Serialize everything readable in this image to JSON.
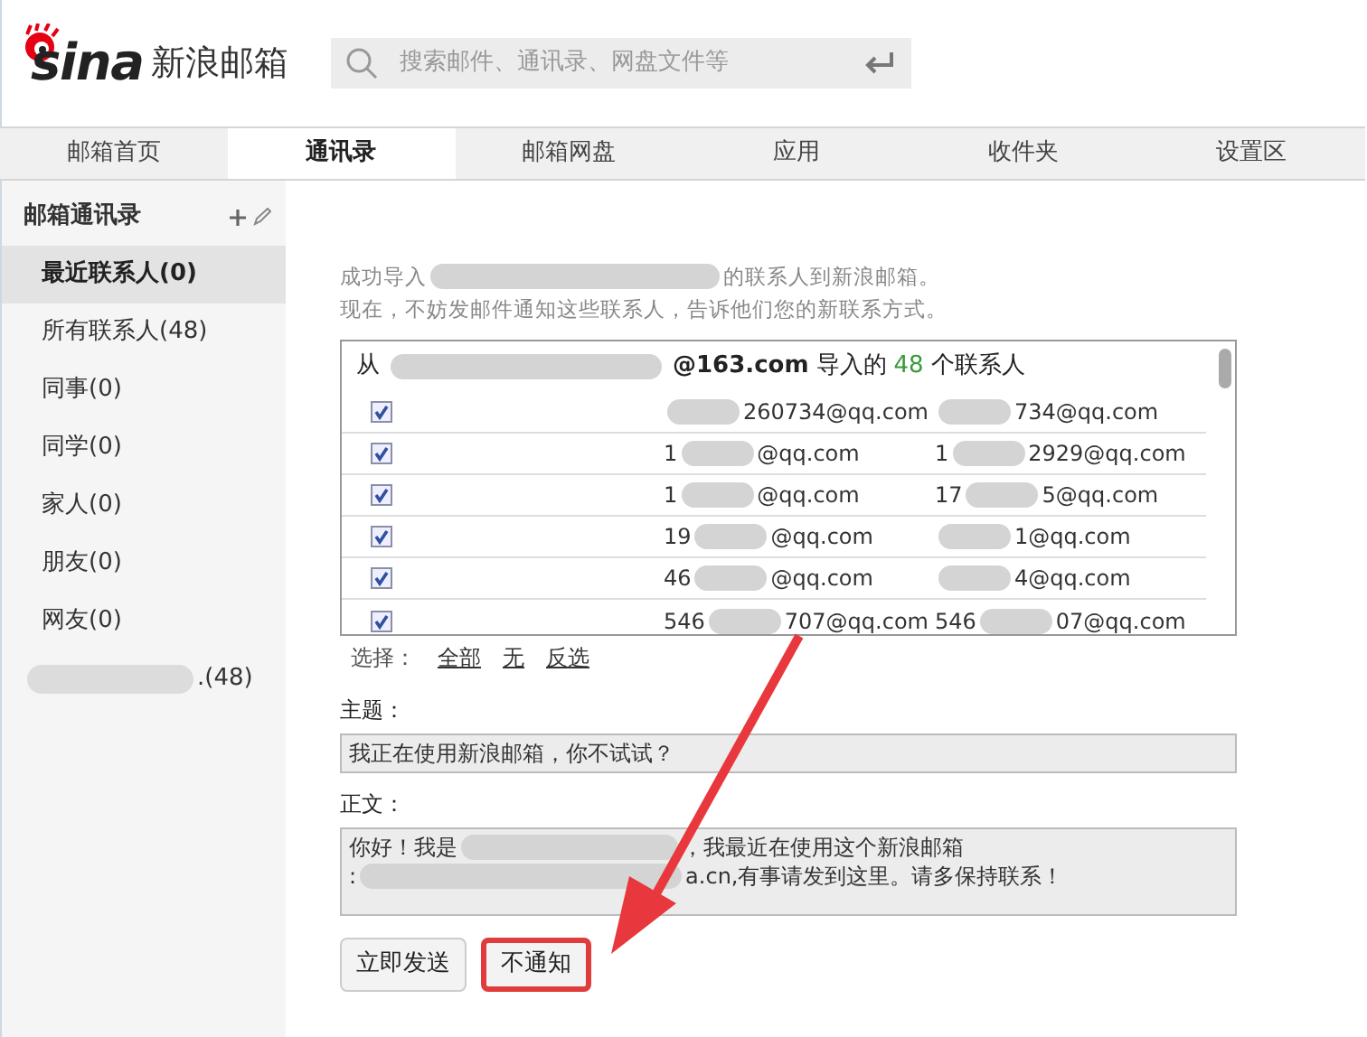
{
  "logo": {
    "brand": "sina",
    "product": "新浪邮箱"
  },
  "search": {
    "placeholder": "搜索邮件、通讯录、网盘文件等"
  },
  "tabs": [
    {
      "label": "邮箱首页",
      "selected": false
    },
    {
      "label": "通讯录",
      "selected": true
    },
    {
      "label": "邮箱网盘",
      "selected": false
    },
    {
      "label": "应用",
      "selected": false
    },
    {
      "label": "收件夹",
      "selected": false
    },
    {
      "label": "设置区",
      "selected": false
    }
  ],
  "sidebar": {
    "title": "邮箱通讯录",
    "items": [
      {
        "label": "最近联系人(0)",
        "selected": true
      },
      {
        "label": "所有联系人(48)",
        "selected": false
      },
      {
        "label": "同事(0)",
        "selected": false
      },
      {
        "label": "同学(0)",
        "selected": false
      },
      {
        "label": "家人(0)",
        "selected": false
      },
      {
        "label": "朋友(0)",
        "selected": false
      },
      {
        "label": "网友(0)",
        "selected": false
      },
      {
        "label": ".(48)",
        "selected": false,
        "redacted": true
      }
    ]
  },
  "intro": [
    {
      "head": "成功导入",
      "tail": "的联系人到新浪邮箱。"
    },
    {
      "head": "现在，不妨发邮件通知这些联系人，告诉他们您的新联系方式。"
    }
  ],
  "contacts": {
    "from": "从",
    "domain": "@163.com",
    "middle": "导入的",
    "count": "48",
    "tail": "个联系人",
    "rows": [
      {
        "checked": true,
        "cells": [
          {
            "tail": "260734@qq.com"
          },
          {
            "tail": "734@qq.com"
          }
        ]
      },
      {
        "checked": true,
        "cells": [
          {
            "head": "1",
            "tail": "@qq.com"
          },
          {
            "head": "1",
            "tail": "2929@qq.com"
          }
        ]
      },
      {
        "checked": true,
        "cells": [
          {
            "head": "1",
            "tail": "@qq.com"
          },
          {
            "head": "17",
            "tail": "5@qq.com"
          }
        ]
      },
      {
        "checked": true,
        "cells": [
          {
            "head": "19",
            "tail": "@qq.com"
          },
          {
            "tail": "1@qq.com"
          }
        ]
      },
      {
        "checked": true,
        "cells": [
          {
            "head": "46",
            "tail": "@qq.com"
          },
          {
            "tail": "4@qq.com"
          }
        ]
      },
      {
        "checked": true,
        "cells": [
          {
            "head": "546",
            "tail": "707@qq.com"
          },
          {
            "head": "546",
            "tail": "07@qq.com"
          }
        ]
      }
    ]
  },
  "select": {
    "label": "选择：",
    "links": [
      "全部",
      "无",
      "反选"
    ]
  },
  "subject": {
    "label": "主题：",
    "value": "我正在使用新浪邮箱，你不试试？"
  },
  "body": {
    "label": "正文：",
    "lines": [
      {
        "head": "你好！我是",
        "tail": "，我最近在使用这个新浪邮箱"
      },
      {
        "head": ":",
        "tail": "a.cn,有事请发到这里。请多保持联系！"
      }
    ]
  },
  "buttons": [
    {
      "label": "立即发送",
      "highlighted": false
    },
    {
      "label": "不通知",
      "highlighted": true
    }
  ]
}
